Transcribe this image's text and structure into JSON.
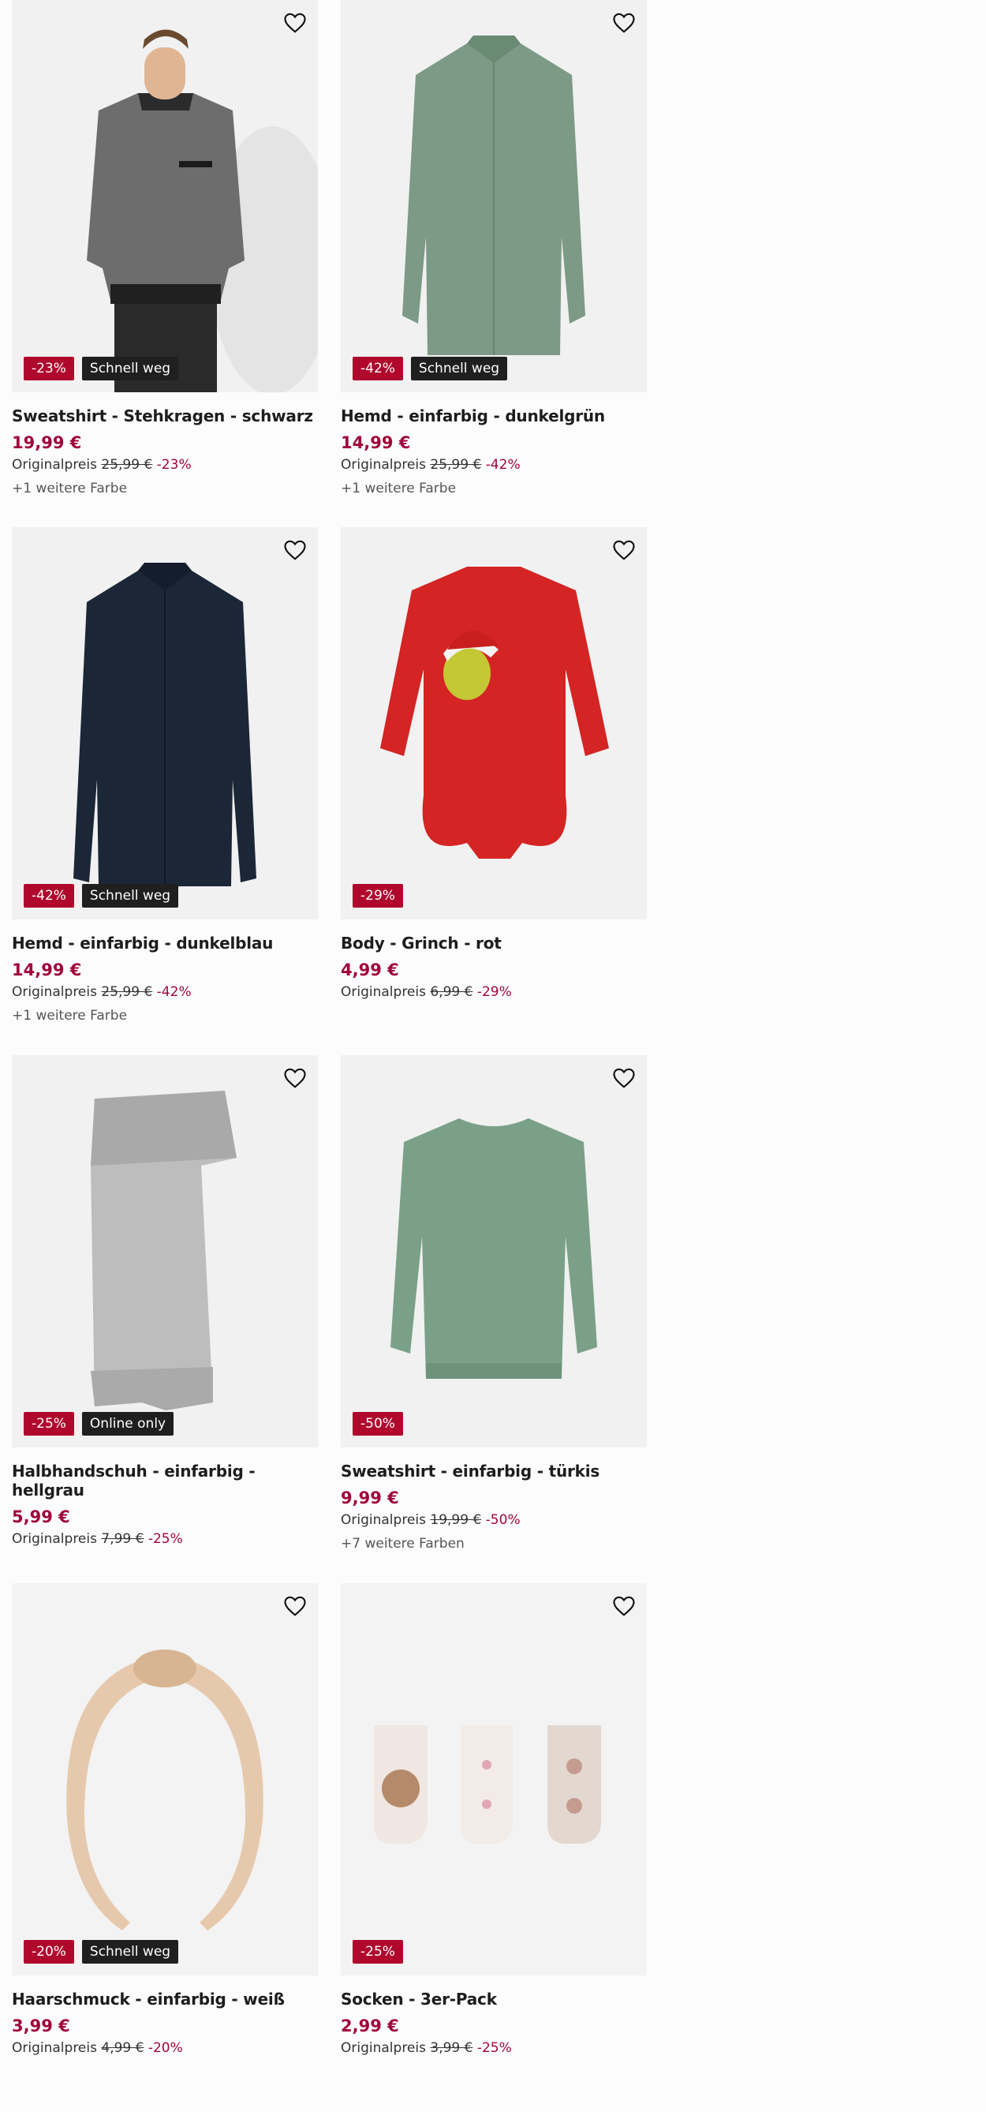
{
  "products": [
    {
      "title": "Sweatshirt - Stehkragen - schwarz",
      "price": "19,99 €",
      "orig_label": "Originalpreis",
      "orig_price": "25,99 €",
      "discount": "-23%",
      "badge_discount": "-23%",
      "badge_flag": "Schnell weg",
      "colors": "+1 weitere Farbe",
      "icon": "sweatshirt-model-image"
    },
    {
      "title": "Hemd - einfarbig - dunkelgrün",
      "price": "14,99 €",
      "orig_label": "Originalpreis",
      "orig_price": "25,99 €",
      "discount": "-42%",
      "badge_discount": "-42%",
      "badge_flag": "Schnell weg",
      "colors": "+1 weitere Farbe",
      "icon": "green-shirt-image"
    },
    {
      "title": "Hemd - einfarbig - dunkelblau",
      "price": "14,99 €",
      "orig_label": "Originalpreis",
      "orig_price": "25,99 €",
      "discount": "-42%",
      "badge_discount": "-42%",
      "badge_flag": "Schnell weg",
      "colors": "+1 weitere Farbe",
      "icon": "navy-shirt-image"
    },
    {
      "title": "Body - Grinch - rot",
      "price": "4,99 €",
      "orig_label": "Originalpreis",
      "orig_price": "6,99 €",
      "discount": "-29%",
      "badge_discount": "-29%",
      "badge_flag": "",
      "colors": "",
      "icon": "red-body-image"
    },
    {
      "title": "Halbhandschuh - einfarbig - hellgrau",
      "price": "5,99 €",
      "orig_label": "Originalpreis",
      "orig_price": "7,99 €",
      "discount": "-25%",
      "badge_discount": "-25%",
      "badge_flag": "Online only",
      "colors": "",
      "icon": "grey-glove-image"
    },
    {
      "title": "Sweatshirt - einfarbig - türkis",
      "price": "9,99 €",
      "orig_label": "Originalpreis",
      "orig_price": "19,99 €",
      "discount": "-50%",
      "badge_discount": "-50%",
      "badge_flag": "",
      "colors": "+7 weitere Farben",
      "icon": "teal-sweatshirt-image"
    },
    {
      "title": "Haarschmuck - einfarbig - weiß",
      "price": "3,99 €",
      "orig_label": "Originalpreis",
      "orig_price": "4,99 €",
      "discount": "-20%",
      "badge_discount": "-20%",
      "badge_flag": "Schnell weg",
      "colors": "",
      "icon": "headband-image"
    },
    {
      "title": "Socken - 3er-Pack",
      "price": "2,99 €",
      "orig_label": "Originalpreis",
      "orig_price": "3,99 €",
      "discount": "-25%",
      "badge_discount": "-25%",
      "badge_flag": "",
      "colors": "",
      "icon": "socks-image"
    }
  ],
  "colors": {
    "discount": "#b0082d",
    "price": "#a0063a",
    "flag": "#1f1f1f",
    "image_bg": "#f3f3f3"
  }
}
